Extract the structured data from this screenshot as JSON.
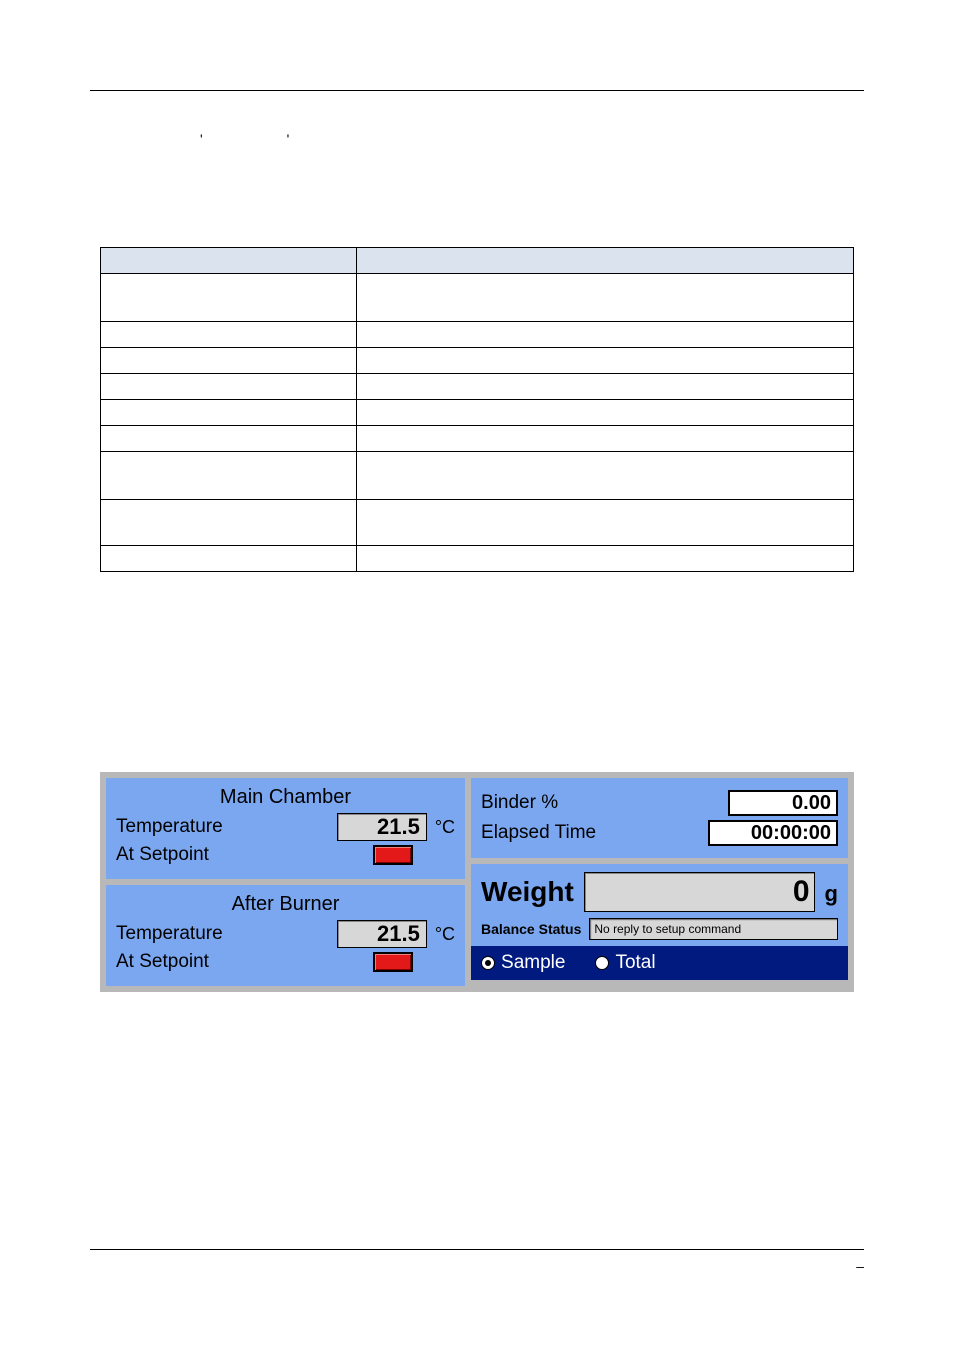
{
  "quotes": "'       '",
  "main_chamber": {
    "title": "Main Chamber",
    "temp_label": "Temperature",
    "temp_value": "21.5",
    "temp_unit": "°C",
    "setpoint_label": "At Setpoint"
  },
  "after_burner": {
    "title": "After Burner",
    "temp_label": "Temperature",
    "temp_value": "21.5",
    "temp_unit": "°C",
    "setpoint_label": "At Setpoint"
  },
  "binder": {
    "label": "Binder %",
    "value": "0.00"
  },
  "elapsed": {
    "label": "Elapsed Time",
    "value": "00:00:00"
  },
  "weight": {
    "label": "Weight",
    "value": "0",
    "unit": "g"
  },
  "balance": {
    "label": "Balance Status",
    "value": "No reply to setup command"
  },
  "radios": {
    "sample": "Sample",
    "total": "Total"
  },
  "footer_dash": "–"
}
